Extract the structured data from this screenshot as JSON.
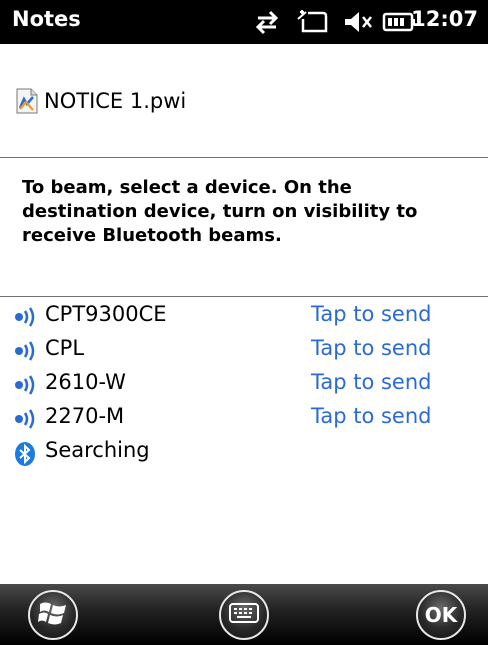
{
  "statusbar": {
    "app_title": "Notes",
    "time": "12:07",
    "icons": [
      "connectivity-arrows-icon",
      "sync-phone-icon",
      "speaker-muted-icon",
      "battery-icon"
    ]
  },
  "file": {
    "icon": "pwi-document-icon",
    "name": "NOTICE 1.pwi"
  },
  "instructions": "To beam, select a device. On the destination device, turn on visibility to receive Bluetooth beams.",
  "devices": [
    {
      "name": "CPT9300CE",
      "action": "Tap to send",
      "icon": "beam-signal-icon"
    },
    {
      "name": "CPL",
      "action": "Tap to send",
      "icon": "beam-signal-icon"
    },
    {
      "name": "2610-W",
      "action": "Tap to send",
      "icon": "beam-signal-icon"
    },
    {
      "name": "2270-M",
      "action": "Tap to send",
      "icon": "beam-signal-icon"
    }
  ],
  "searching": {
    "icon": "bluetooth-icon",
    "label": "Searching"
  },
  "softkeys": {
    "start_icon": "windows-start-icon",
    "keyboard_icon": "keyboard-icon",
    "ok_label": "OK"
  },
  "colors": {
    "link": "#2a6bd3",
    "bluetooth": "#1a7ce0"
  }
}
